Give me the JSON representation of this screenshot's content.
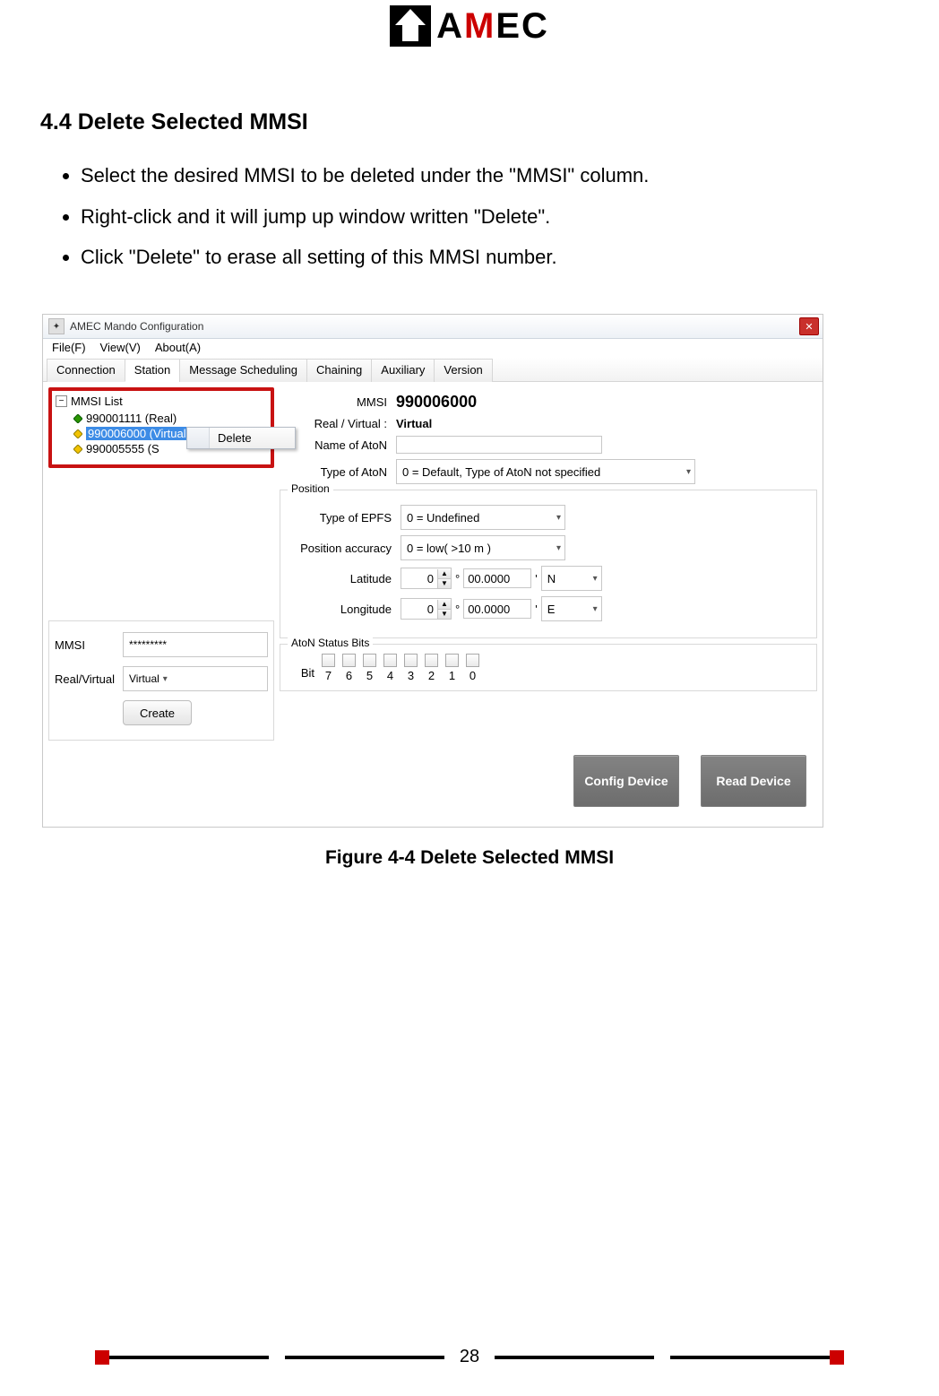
{
  "logo": {
    "text1": "A",
    "text2": "M",
    "text3": "EC"
  },
  "section": {
    "heading": "4.4 Delete Selected MMSI"
  },
  "bullets": [
    "Select the desired MMSI to be deleted under the \"MMSI\" column.",
    "Right-click and it will jump up window written \"Delete\".",
    "Click \"Delete\" to erase all setting of this MMSI number."
  ],
  "window": {
    "title": "AMEC Mando Configuration",
    "closeGlyph": "✕",
    "menus": [
      "File(F)",
      "View(V)",
      "About(A)"
    ],
    "tabs": [
      "Connection",
      "Station",
      "Message Scheduling",
      "Chaining",
      "Auxiliary",
      "Version"
    ],
    "activeTab": "Station"
  },
  "tree": {
    "rootLabel": "MMSI List",
    "items": [
      {
        "text": "990001111  (Real)"
      },
      {
        "text": "990006000  (Virtual)",
        "selected": true
      },
      {
        "text": "990005555  (S"
      }
    ],
    "contextMenu": {
      "label": "Delete"
    }
  },
  "createPanel": {
    "mmsiLabel": "MMSI",
    "mmsiValue": "*********",
    "rvLabel": "Real/Virtual",
    "rvValue": "Virtual",
    "createLabel": "Create"
  },
  "form": {
    "mmsiLabel": "MMSI",
    "mmsiValue": "990006000",
    "rvLabel": "Real / Virtual :",
    "rvValue": "Virtual",
    "nameLabel": "Name of AtoN",
    "nameValue": "",
    "typeLabel": "Type of AtoN",
    "typeValue": "0 = Default, Type of AtoN not specified",
    "posLegend": "Position",
    "epfsLabel": "Type of EPFS",
    "epfsValue": "0 = Undefined",
    "accLabel": "Position accuracy",
    "accValue": "0 = low( >10 m )",
    "latLabel": "Latitude",
    "lonLabel": "Longitude",
    "latDeg": "0",
    "latMin": "00.0000",
    "latDir": "N",
    "lonDeg": "0",
    "lonMin": "00.0000",
    "lonDir": "E",
    "degSym": "°",
    "minSym": "'",
    "bitsLegend": "AtoN Status Bits",
    "bitsRowLabel": "Bit",
    "bitNumbers": [
      "7",
      "6",
      "5",
      "4",
      "3",
      "2",
      "1",
      "0"
    ]
  },
  "bigButtons": {
    "config": "Config Device",
    "read": "Read Device"
  },
  "caption": "Figure 4-4 Delete Selected MMSI",
  "pageNumber": "28"
}
